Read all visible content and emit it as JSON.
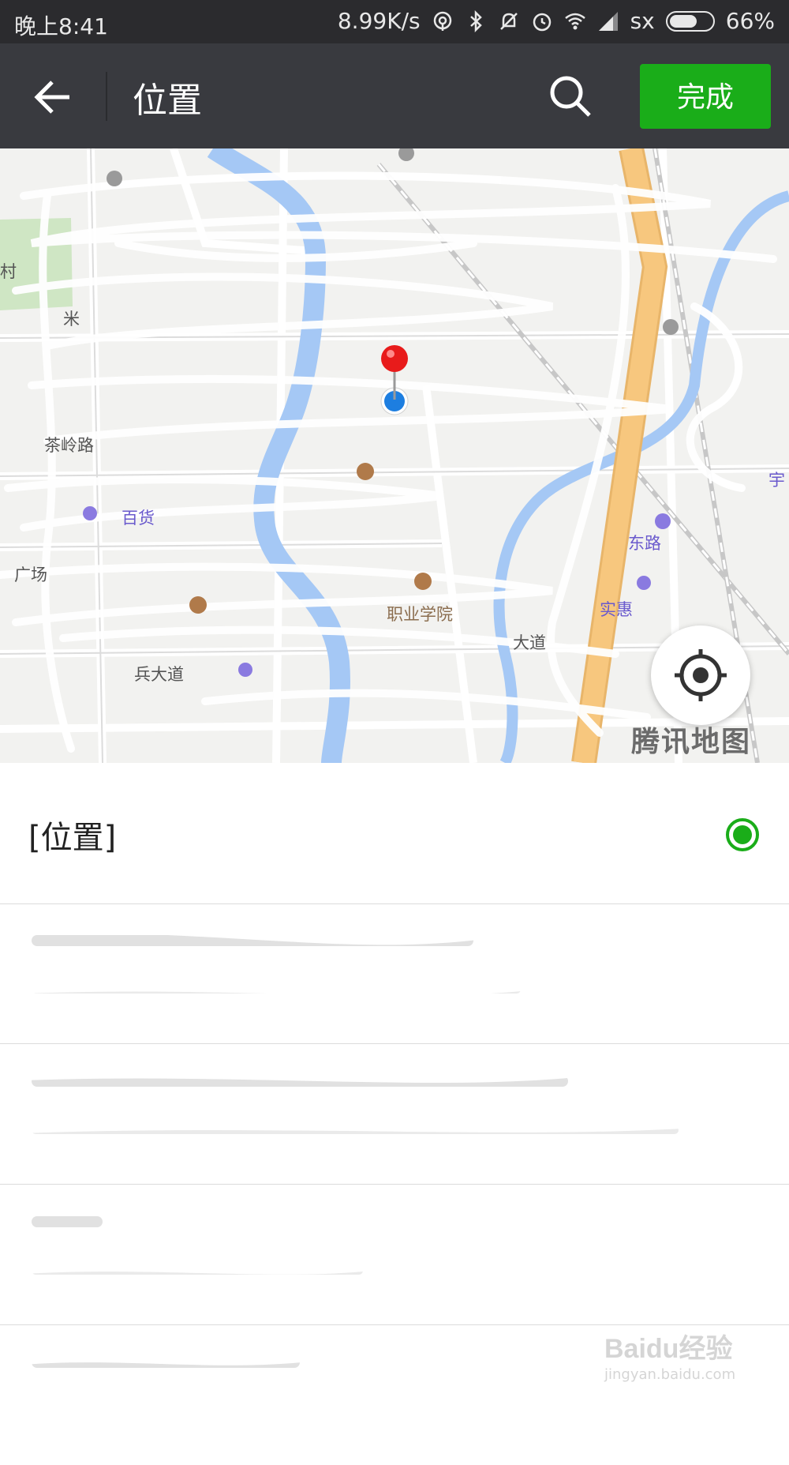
{
  "status_bar": {
    "time": "晚上8:41",
    "network_speed": "8.99K/s",
    "carrier": "sx",
    "battery": "66%",
    "battery_level": 0.66,
    "icons": [
      "hotspot-icon",
      "bluetooth-icon",
      "mute-icon",
      "alarm-icon",
      "wifi-icon",
      "signal-icon",
      "battery-icon"
    ]
  },
  "header": {
    "title": "位置",
    "done_label": "完成"
  },
  "map": {
    "labels": {
      "village": "村",
      "road_tealing": "茶岭路",
      "dept_store": "百货",
      "college": "职业学院",
      "shihui": "实惠",
      "road_east": "东路",
      "road_ave": "大道",
      "square": "广场",
      "road_mi": "米",
      "road_bing": "兵大道",
      "yu": "宇"
    },
    "logo": "腾讯地图",
    "colors": {
      "river": "#a5c8f5",
      "highway": "#f7c77e",
      "land": "#f2f2f0",
      "green": "#cfe6c4",
      "pin_red": "#e81b1b",
      "pin_blue": "#1d7ee0"
    }
  },
  "list": {
    "current": "[位置]",
    "selected_color": "#1aad19"
  },
  "watermark": {
    "brand": "Baidu经验",
    "url": "jingyan.baidu.com"
  }
}
